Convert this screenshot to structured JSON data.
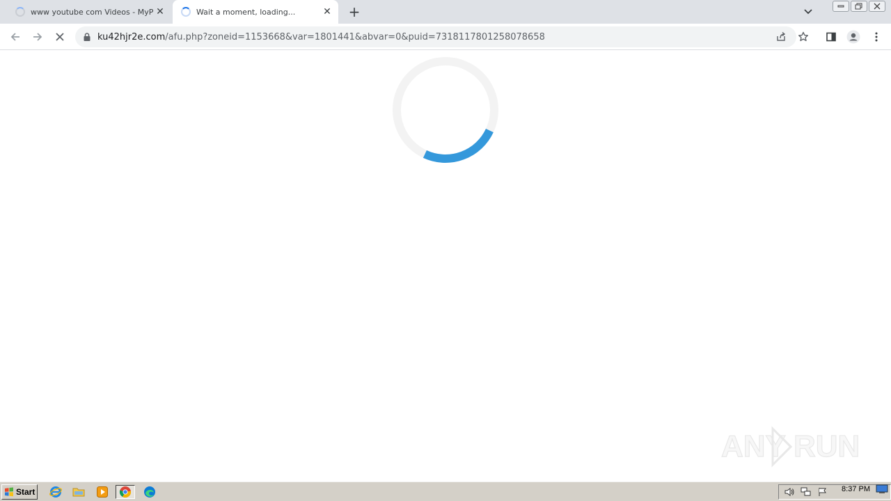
{
  "browser": {
    "tabs": [
      {
        "title": "www youtube com Videos - MyPornW",
        "active": false
      },
      {
        "title": "Wait a moment, loading...",
        "active": true
      }
    ],
    "new_tab_symbol": "+",
    "close_symbol": "✕",
    "url_host": "ku42hjr2e.com",
    "url_path": "/afu.php?zoneid=1153668&var=1801441&abvar=0&puid=7318117801258078658"
  },
  "page": {
    "loading_progress": 0.25,
    "spinner_color": "#3498db",
    "spinner_track_color": "#f3f3f3"
  },
  "watermark": {
    "text_left": "ANY",
    "text_right": "RUN"
  },
  "taskbar": {
    "start_label": "Start",
    "clock": "8:37 PM",
    "apps": [
      "ie-icon",
      "explorer-icon",
      "media-player-icon",
      "chrome-icon",
      "edge-icon"
    ]
  }
}
